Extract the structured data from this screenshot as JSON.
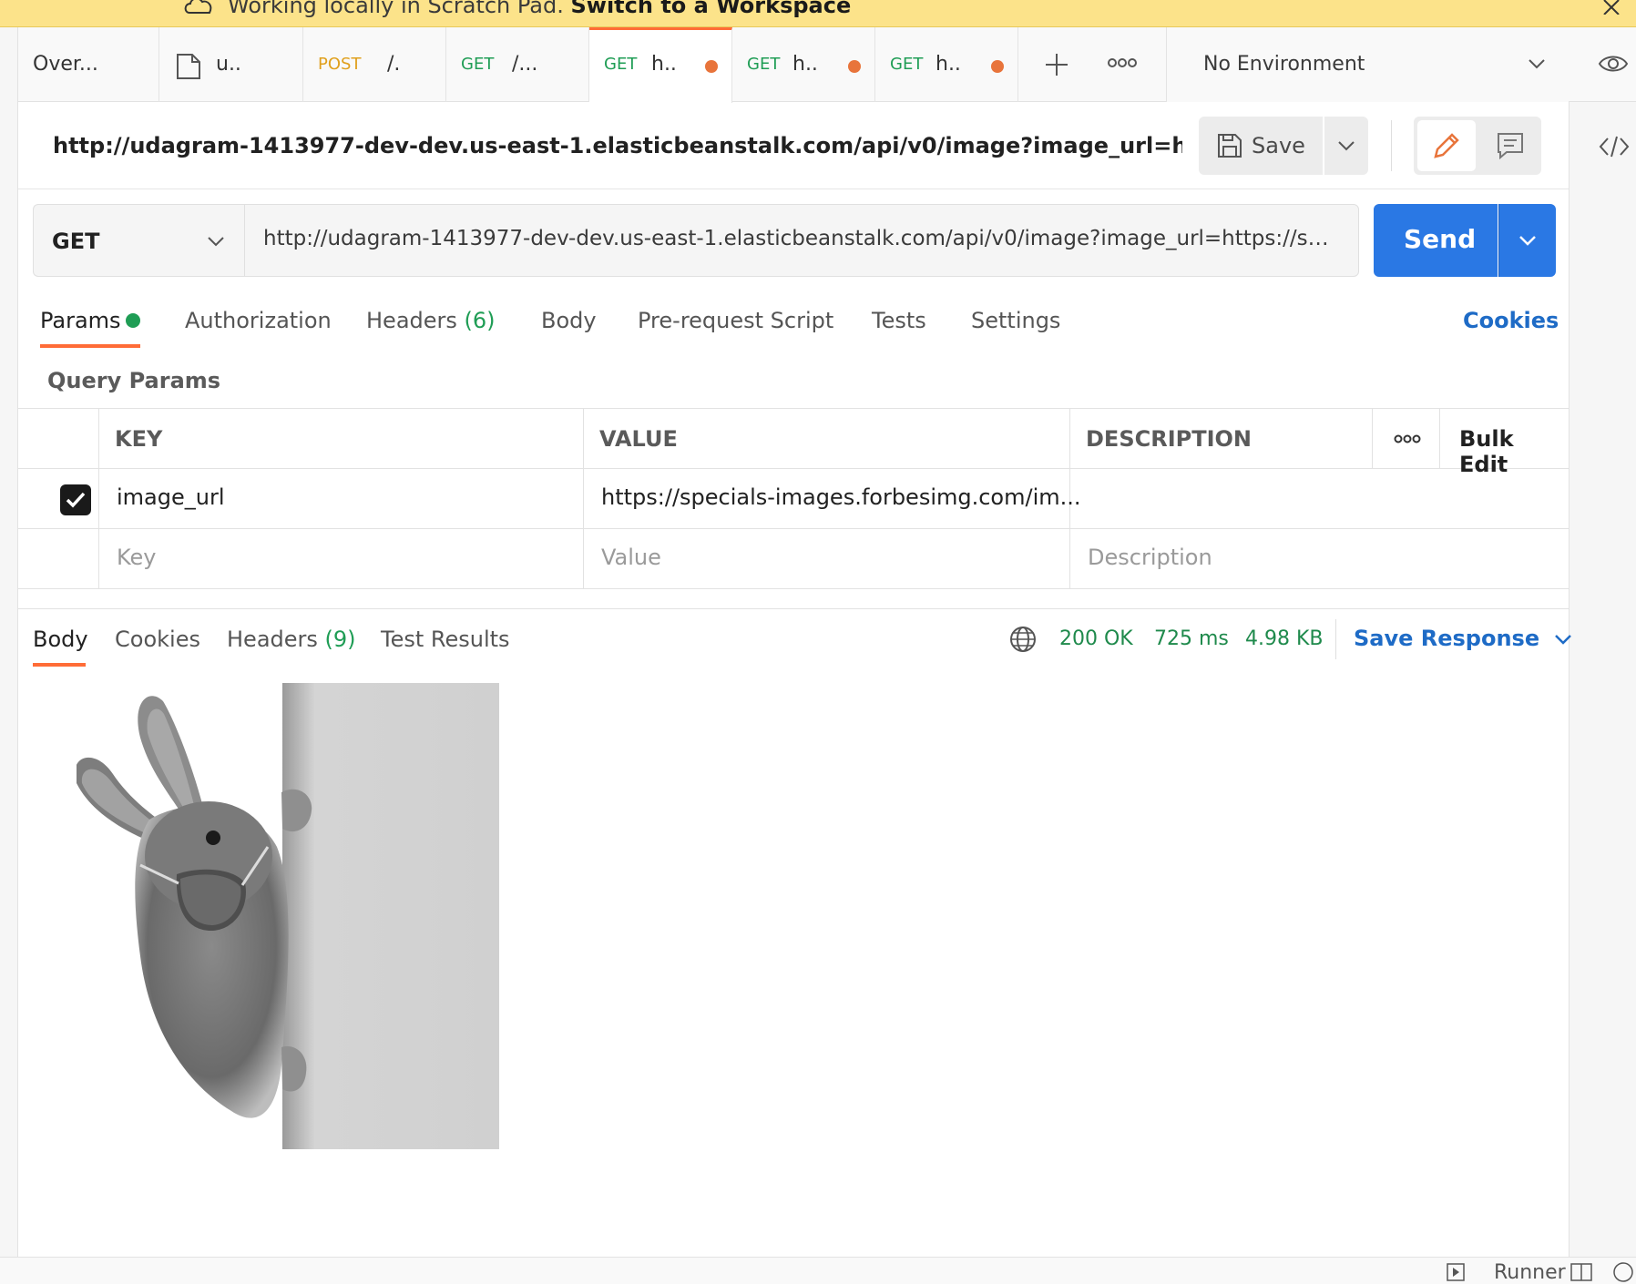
{
  "banner": {
    "prefix": "Working locally in Scratch Pad.",
    "link": "Switch to a Workspace"
  },
  "tabs": [
    {
      "method": "",
      "title": "Over..."
    },
    {
      "method": "",
      "title": "u.."
    },
    {
      "method": "POST",
      "title": "/."
    },
    {
      "method": "GET",
      "title": "/..."
    },
    {
      "method": "GET",
      "title": "h.."
    },
    {
      "method": "GET",
      "title": "h.."
    },
    {
      "method": "GET",
      "title": "h.."
    }
  ],
  "environment": {
    "selected": "No Environment"
  },
  "request": {
    "title": "http://udagram-1413977-dev-dev.us-east-1.elasticbeanstalk.com/api/v0/image?image_url=https://speci...",
    "save_label": "Save",
    "method": "GET",
    "url": "http://udagram-1413977-dev-dev.us-east-1.elasticbeanstalk.com/api/v0/image?image_url=https://spe ...",
    "send_label": "Send"
  },
  "request_tabs": {
    "params": "Params",
    "authorization": "Authorization",
    "headers": "Headers",
    "headers_count": "(6)",
    "body": "Body",
    "prerequest": "Pre-request Script",
    "tests": "Tests",
    "settings": "Settings",
    "cookies": "Cookies"
  },
  "query_params": {
    "title": "Query Params",
    "headers": {
      "key": "KEY",
      "value": "VALUE",
      "description": "DESCRIPTION",
      "bulk_edit": "Bulk Edit"
    },
    "rows": [
      {
        "key": "image_url",
        "value": "https://specials-images.forbesimg.com/im..."
      }
    ],
    "placeholders": {
      "key": "Key",
      "value": "Value",
      "description": "Description"
    }
  },
  "response": {
    "tabs": {
      "body": "Body",
      "cookies": "Cookies",
      "headers": "Headers",
      "headers_count": "(9)",
      "test_results": "Test Results"
    },
    "status": "200 OK",
    "time": "725 ms",
    "size": "4.98 KB",
    "save_response": "Save Response"
  },
  "footer": {
    "runner": "Runner"
  },
  "colors": {
    "accent": "#ff6c37",
    "send": "#2a78e4",
    "link": "#1e6bc6",
    "success": "#1f9d55",
    "banner": "#fce38a"
  }
}
